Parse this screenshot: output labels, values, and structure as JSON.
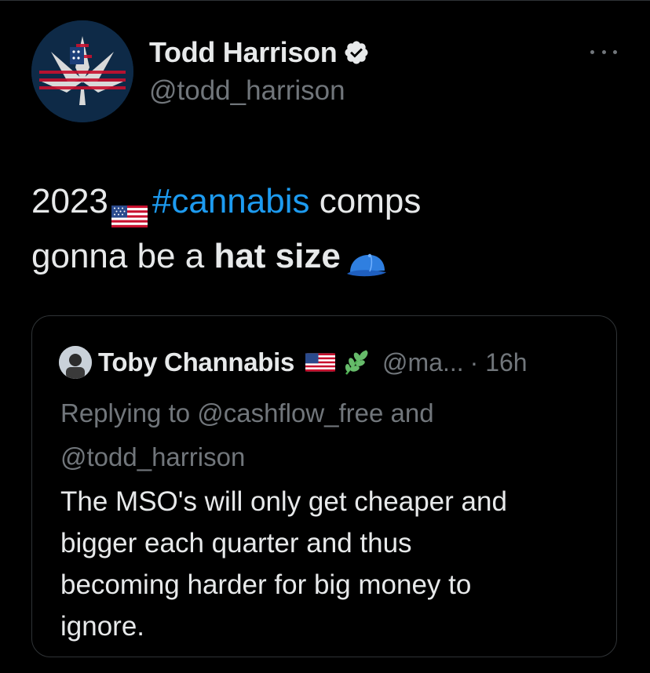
{
  "colors": {
    "background": "#000000",
    "text_primary": "#e7e9ea",
    "text_secondary": "#71767b",
    "link": "#1d9bf0",
    "border": "#2f3336"
  },
  "tweet": {
    "author": {
      "name": "Todd Harrison",
      "handle": "@todd_harrison",
      "verified": true,
      "avatar_icon": "us-flag-cannabis-leaf-avatar"
    },
    "more_icon": "more-options-icon",
    "text": {
      "year": "2023",
      "flag_icon": "us-flag-emoji",
      "hashtag": "#cannabis",
      "after_hashtag": " comps",
      "line2_prefix": "gonna be a ",
      "bold_phrase": "hat size",
      "cap_icon": "blue-cap-emoji"
    }
  },
  "quoted_tweet": {
    "author": {
      "name": "Toby Channabis",
      "handle": "@ma...",
      "time": "· 16h",
      "flag_icon": "us-flag-emoji",
      "herb_icon": "herb-emoji"
    },
    "replying_to": {
      "line1": "Replying to @cashflow_free and",
      "line2": "@todd_harrison"
    },
    "body_lines": [
      "The MSO's will only get cheaper and",
      "bigger each quarter and thus",
      "becoming harder for big money to",
      "ignore."
    ]
  }
}
